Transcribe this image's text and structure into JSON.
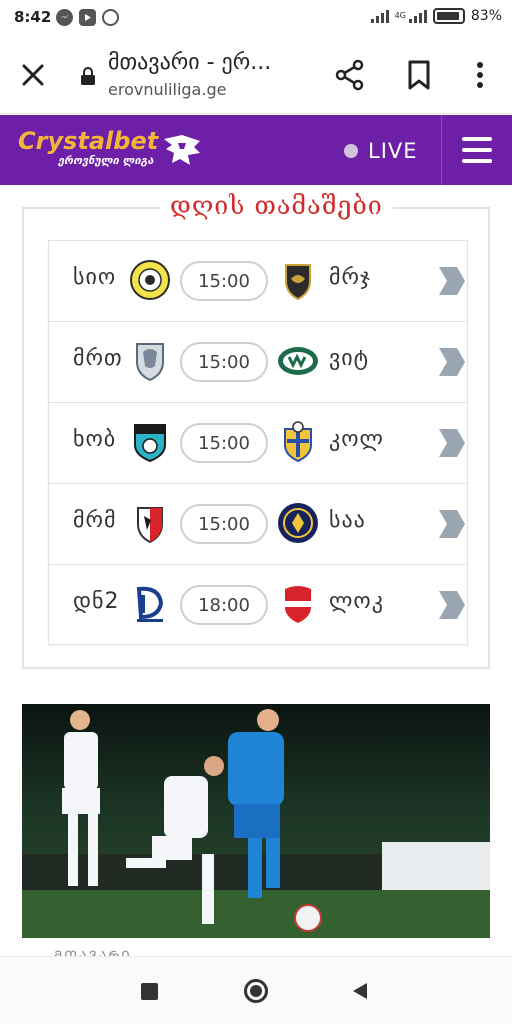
{
  "status_bar": {
    "time": "8:42",
    "network": "4G",
    "battery": "83%",
    "notification_icons": [
      "messenger-icon",
      "youtube-icon",
      "whatsapp-icon"
    ]
  },
  "browser": {
    "page_title": "მთავარი - ერ...",
    "url": "erovnuliliga.ge"
  },
  "site_header": {
    "brand": "Crystalbet",
    "brand_sub": "ეროვნული ლიგა",
    "live_label": "LIVE",
    "colors": {
      "header_bg": "#6d1fa8",
      "brand": "#f2b53a"
    }
  },
  "matches_section": {
    "title": "დღის თამაშები",
    "matches": [
      {
        "home": "სიო",
        "time": "15:00",
        "away": "მრჯ"
      },
      {
        "home": "მრთ",
        "time": "15:00",
        "away": "ვიტ"
      },
      {
        "home": "ხობ",
        "time": "15:00",
        "away": "კოლ"
      },
      {
        "home": "მრმ",
        "time": "15:00",
        "away": "საა"
      },
      {
        "home": "დნ2",
        "time": "18:00",
        "away": "ლოკ"
      }
    ]
  },
  "news": {
    "peek_text": "ᲛᲗᲐᲕᲐᲠᲘ"
  }
}
